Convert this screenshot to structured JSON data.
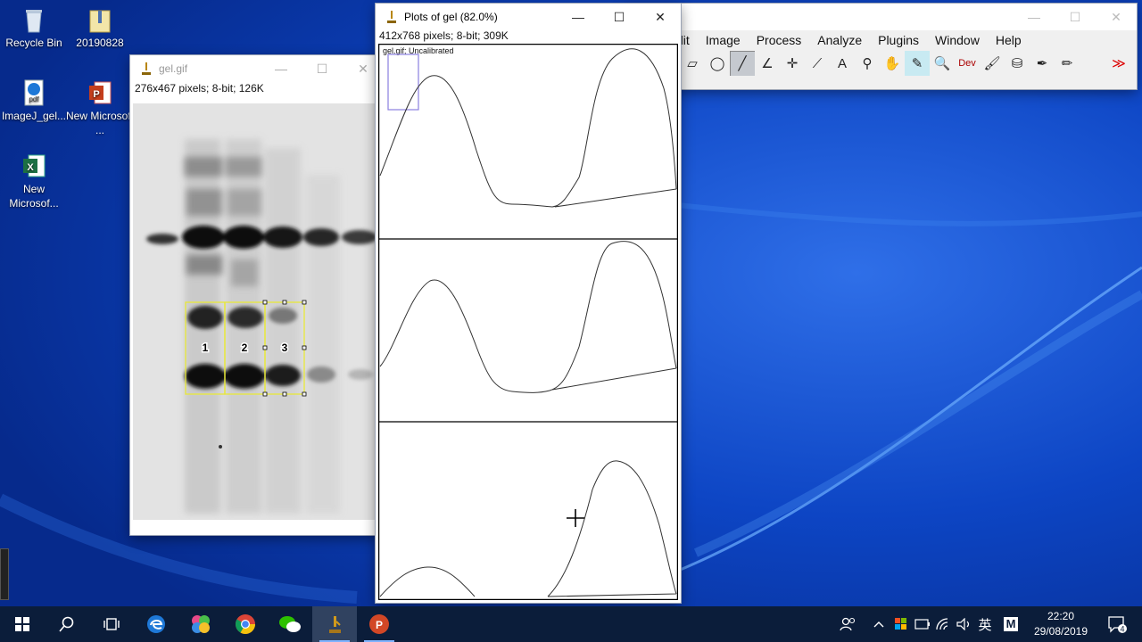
{
  "desktop": {
    "icons": [
      {
        "label": "Recycle Bin",
        "icon": "recycle-bin-icon"
      },
      {
        "label": "20190828",
        "icon": "folder-zip-icon"
      },
      {
        "label": "ImageJ_gel...",
        "icon": "edge-pdf-icon",
        "badge": "pdf"
      },
      {
        "label": "New Microsoft ...",
        "icon": "powerpoint-file-icon",
        "badge": "P"
      },
      {
        "label": "New Microsof...",
        "icon": "excel-file-icon",
        "badge": "X"
      }
    ]
  },
  "imagej": {
    "menus": [
      "dit",
      "Image",
      "Process",
      "Analyze",
      "Plugins",
      "Window",
      "Help"
    ],
    "tools": [
      {
        "name": "polygon-tool",
        "glyph": "▱"
      },
      {
        "name": "freehand-tool",
        "glyph": "◯"
      },
      {
        "name": "straight-line-tool",
        "glyph": "╱"
      },
      {
        "name": "angle-tool",
        "glyph": "∠"
      },
      {
        "name": "point-tool",
        "glyph": "✛"
      },
      {
        "name": "wand-tool",
        "glyph": "⟋"
      },
      {
        "name": "text-tool",
        "glyph": "A"
      },
      {
        "name": "magnifier-tool",
        "glyph": "⚲"
      },
      {
        "name": "scroll-tool",
        "glyph": "✋"
      },
      {
        "name": "color-picker-tool",
        "glyph": "✎"
      },
      {
        "name": "zoom-tool",
        "glyph": "🔍"
      },
      {
        "name": "developer-menu",
        "glyph": "Dev"
      },
      {
        "name": "brush-tool",
        "glyph": "🖌"
      },
      {
        "name": "flood-fill-tool",
        "glyph": "⛁"
      },
      {
        "name": "pipette-tool",
        "glyph": "✒"
      },
      {
        "name": "pencil-tool",
        "glyph": "✏"
      },
      {
        "name": "blank-slot",
        "glyph": ""
      },
      {
        "name": "more-tools-menu",
        "glyph": "≫"
      }
    ]
  },
  "gel_window": {
    "title": "gel.gif",
    "info": "276x467 pixels; 8-bit; 126K",
    "lane_labels": [
      "1",
      "2",
      "3"
    ]
  },
  "plots_window": {
    "title": "Plots of gel (82.0%)",
    "info": "412x768 pixels; 8-bit; 309K",
    "plot_caption": "gel.gif; Uncalibrated"
  },
  "taskbar": {
    "apps": [
      {
        "name": "start-button",
        "running": false
      },
      {
        "name": "search-button",
        "running": false
      },
      {
        "name": "task-view-button",
        "running": false
      },
      {
        "name": "edge-app",
        "running": false
      },
      {
        "name": "clover-app",
        "running": false
      },
      {
        "name": "chrome-app",
        "running": false
      },
      {
        "name": "wechat-app",
        "running": false
      },
      {
        "name": "imagej-app",
        "running": true,
        "current": true
      },
      {
        "name": "powerpoint-app",
        "running": true
      }
    ],
    "ime": "英",
    "ime_mode": "M",
    "time": "22:20",
    "date": "29/08/2019",
    "notification_count": "4"
  }
}
